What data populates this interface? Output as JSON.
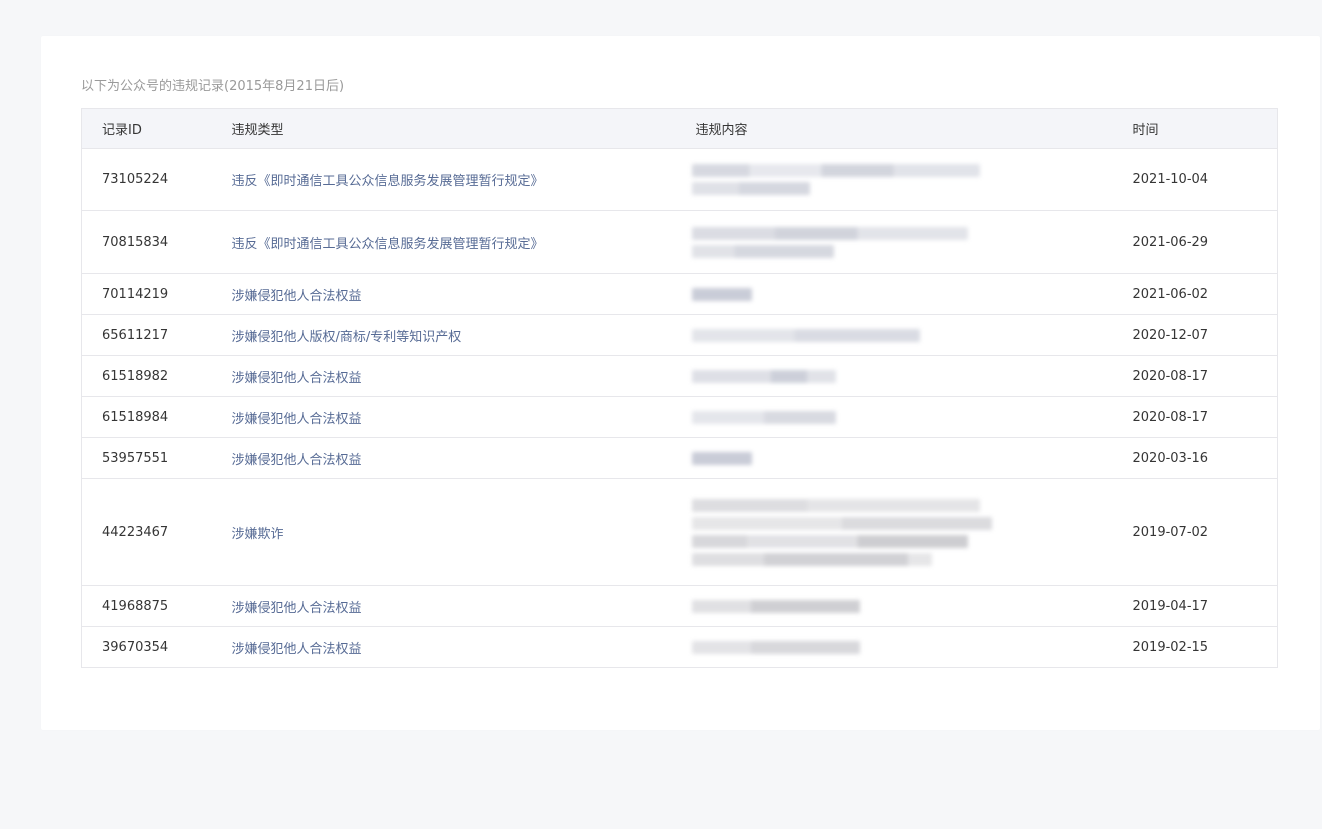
{
  "caption": "以下为公众号的违规记录(2015年8月21日后)",
  "columns": {
    "id": "记录ID",
    "type": "违规类型",
    "content": "违规内容",
    "time": "时间"
  },
  "rows": [
    {
      "id": "73105224",
      "type": "违反《即时通信工具公众信息服务发展管理暂行规定》",
      "time": "2021-10-04"
    },
    {
      "id": "70815834",
      "type": "违反《即时通信工具公众信息服务发展管理暂行规定》",
      "time": "2021-06-29"
    },
    {
      "id": "70114219",
      "type": "涉嫌侵犯他人合法权益",
      "time": "2021-06-02"
    },
    {
      "id": "65611217",
      "type": "涉嫌侵犯他人版权/商标/专利等知识产权",
      "time": "2020-12-07"
    },
    {
      "id": "61518982",
      "type": "涉嫌侵犯他人合法权益",
      "time": "2020-08-17"
    },
    {
      "id": "61518984",
      "type": "涉嫌侵犯他人合法权益",
      "time": "2020-08-17"
    },
    {
      "id": "53957551",
      "type": "涉嫌侵犯他人合法权益",
      "time": "2020-03-16"
    },
    {
      "id": "44223467",
      "type": "涉嫌欺诈",
      "time": "2019-07-02"
    },
    {
      "id": "41968875",
      "type": "涉嫌侵犯他人合法权益",
      "time": "2019-04-17"
    },
    {
      "id": "39670354",
      "type": "涉嫌侵犯他人合法权益",
      "time": "2019-02-15"
    }
  ],
  "colors": {
    "link": "#576b95",
    "text": "#353535",
    "muted": "#9a9a9a",
    "border": "#e7e7eb",
    "header_bg": "#f4f5f9",
    "page_bg": "#f6f7f9"
  }
}
